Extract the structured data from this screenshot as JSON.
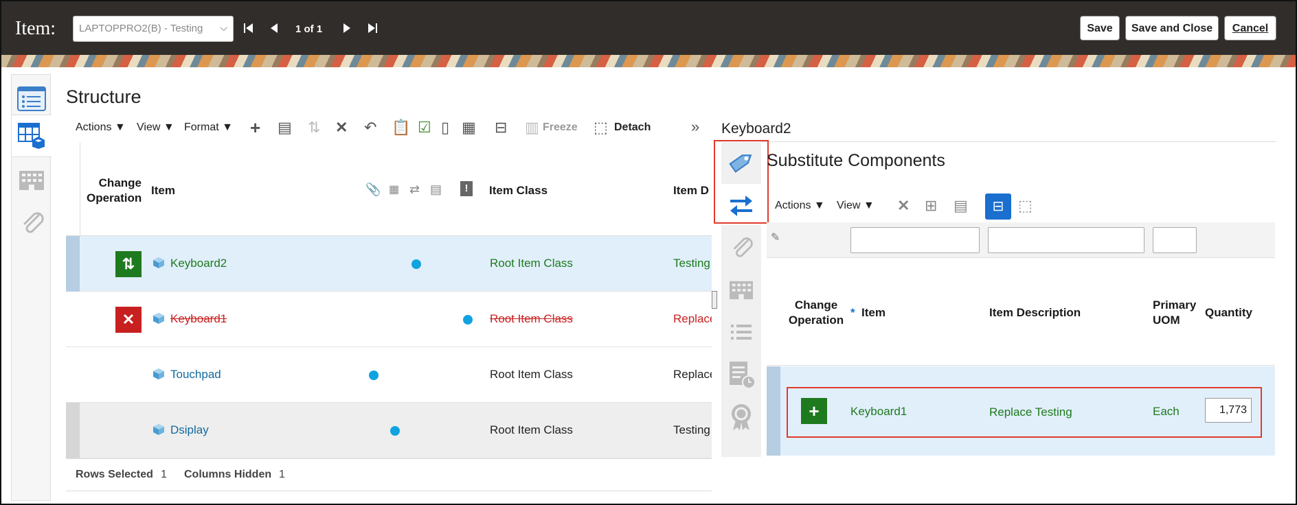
{
  "header": {
    "title": "Item:",
    "item_value": "LAPTOPPRO2(B) - Testing",
    "pager": "1 of 1",
    "save": "Save",
    "save_close": "Save and Close",
    "cancel": "Cancel"
  },
  "structure": {
    "heading": "Structure",
    "toolbar": {
      "actions": "Actions",
      "view": "View",
      "format": "Format",
      "freeze": "Freeze",
      "detach": "Detach"
    },
    "columns": {
      "change_operation": "Change Operation",
      "item": "Item",
      "item_class": "Item Class",
      "item_desc": "Item D"
    },
    "rows": [
      {
        "item": "Keyboard2",
        "item_class": "Root Item Class",
        "desc": "Testing",
        "op": "replace",
        "style": "selected"
      },
      {
        "item": "Keyboard1",
        "item_class": "Root Item Class",
        "desc": "Replace",
        "op": "delete",
        "style": "deleted"
      },
      {
        "item": "Touchpad",
        "item_class": "Root Item Class",
        "desc": "Replace",
        "op": "none",
        "style": "normal"
      },
      {
        "item": "Dsiplay",
        "item_class": "Root Item Class",
        "desc": "Testing",
        "op": "none",
        "style": "grey"
      }
    ],
    "footer": {
      "rows_selected_label": "Rows Selected",
      "rows_selected": "1",
      "columns_hidden_label": "Columns Hidden",
      "columns_hidden": "1"
    }
  },
  "detail": {
    "title": "Keyboard2",
    "section": "Substitute Components",
    "toolbar": {
      "actions": "Actions",
      "view": "View"
    },
    "columns": {
      "change_operation": "Change Operation",
      "required": "*",
      "item": "Item",
      "item_desc": "Item Description",
      "primary_uom": "Primary UOM",
      "quantity": "Quantity"
    },
    "row": {
      "item": "Keyboard1",
      "desc": "Replace Testing",
      "uom": "Each",
      "quantity": "1,773"
    }
  },
  "colors": {
    "accent_blue": "#1a6fcf",
    "green_text": "#1e7a1e",
    "red_text": "#c82020",
    "link_blue": "#116a9c",
    "highlight": "#e1effb",
    "annotation_red": "#e03a2a"
  }
}
